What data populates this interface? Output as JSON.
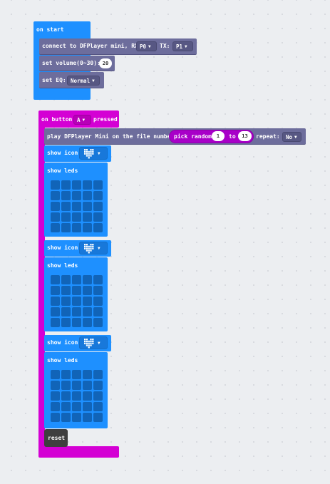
{
  "on_start": {
    "label": "on start",
    "connect": {
      "text": "connect to DFPlayer mini, RX:",
      "rx_value": "P0",
      "tx_label": "TX:",
      "tx_value": "P1"
    },
    "volume": {
      "text": "set volume(0~30):",
      "value": "20"
    },
    "eq": {
      "text": "set EQ:",
      "value": "Normal"
    }
  },
  "on_button": {
    "prefix": "on button",
    "button": "A",
    "suffix": "pressed",
    "play": {
      "text": "play DFPlayer Mini on the file number:",
      "random_label": "pick random",
      "from": "1",
      "to_label": "to",
      "to": "13",
      "repeat_label": "repeat:",
      "repeat_value": "No"
    },
    "show_icon_label": "show icon",
    "show_leds_label": "show leds",
    "icon_name": "heart",
    "reset_label": "reset"
  },
  "colors": {
    "basic": "#1e90ff",
    "dfplayer": "#6d6d9c",
    "input": "#d400d4",
    "control": "#4a4a4a"
  }
}
